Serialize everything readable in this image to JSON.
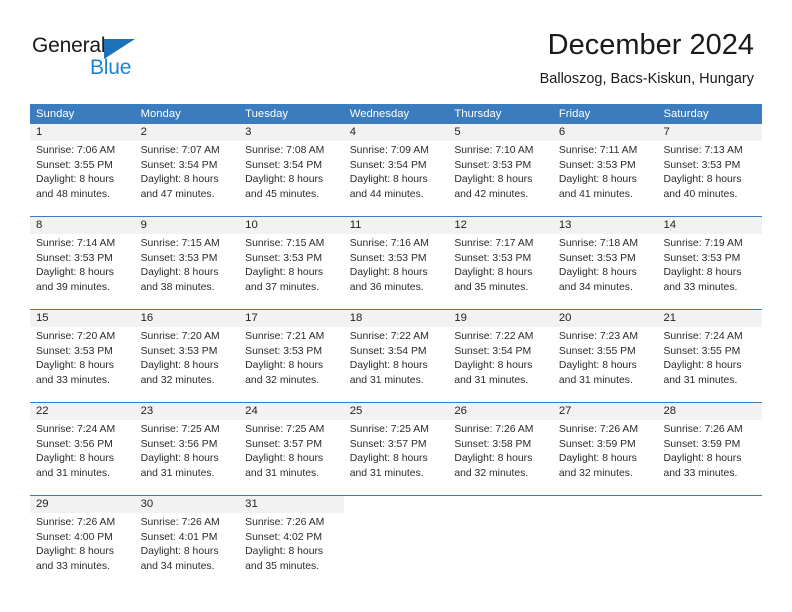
{
  "brand": {
    "name_dark": "General",
    "name_light": "Blue"
  },
  "header": {
    "title": "December 2024",
    "subtitle": "Balloszog, Bacs-Kiskun, Hungary"
  },
  "colors": {
    "header_blue": "#3a7cbe",
    "logo_blue": "#1c86d4",
    "daynum_bg": "#f2f2f2"
  },
  "weekdays": [
    "Sunday",
    "Monday",
    "Tuesday",
    "Wednesday",
    "Thursday",
    "Friday",
    "Saturday"
  ],
  "weeks": [
    [
      {
        "day": "1",
        "sunrise": "Sunrise: 7:06 AM",
        "sunset": "Sunset: 3:55 PM",
        "daylight1": "Daylight: 8 hours",
        "daylight2": "and 48 minutes."
      },
      {
        "day": "2",
        "sunrise": "Sunrise: 7:07 AM",
        "sunset": "Sunset: 3:54 PM",
        "daylight1": "Daylight: 8 hours",
        "daylight2": "and 47 minutes."
      },
      {
        "day": "3",
        "sunrise": "Sunrise: 7:08 AM",
        "sunset": "Sunset: 3:54 PM",
        "daylight1": "Daylight: 8 hours",
        "daylight2": "and 45 minutes."
      },
      {
        "day": "4",
        "sunrise": "Sunrise: 7:09 AM",
        "sunset": "Sunset: 3:54 PM",
        "daylight1": "Daylight: 8 hours",
        "daylight2": "and 44 minutes."
      },
      {
        "day": "5",
        "sunrise": "Sunrise: 7:10 AM",
        "sunset": "Sunset: 3:53 PM",
        "daylight1": "Daylight: 8 hours",
        "daylight2": "and 42 minutes."
      },
      {
        "day": "6",
        "sunrise": "Sunrise: 7:11 AM",
        "sunset": "Sunset: 3:53 PM",
        "daylight1": "Daylight: 8 hours",
        "daylight2": "and 41 minutes."
      },
      {
        "day": "7",
        "sunrise": "Sunrise: 7:13 AM",
        "sunset": "Sunset: 3:53 PM",
        "daylight1": "Daylight: 8 hours",
        "daylight2": "and 40 minutes."
      }
    ],
    [
      {
        "day": "8",
        "sunrise": "Sunrise: 7:14 AM",
        "sunset": "Sunset: 3:53 PM",
        "daylight1": "Daylight: 8 hours",
        "daylight2": "and 39 minutes."
      },
      {
        "day": "9",
        "sunrise": "Sunrise: 7:15 AM",
        "sunset": "Sunset: 3:53 PM",
        "daylight1": "Daylight: 8 hours",
        "daylight2": "and 38 minutes."
      },
      {
        "day": "10",
        "sunrise": "Sunrise: 7:15 AM",
        "sunset": "Sunset: 3:53 PM",
        "daylight1": "Daylight: 8 hours",
        "daylight2": "and 37 minutes."
      },
      {
        "day": "11",
        "sunrise": "Sunrise: 7:16 AM",
        "sunset": "Sunset: 3:53 PM",
        "daylight1": "Daylight: 8 hours",
        "daylight2": "and 36 minutes."
      },
      {
        "day": "12",
        "sunrise": "Sunrise: 7:17 AM",
        "sunset": "Sunset: 3:53 PM",
        "daylight1": "Daylight: 8 hours",
        "daylight2": "and 35 minutes."
      },
      {
        "day": "13",
        "sunrise": "Sunrise: 7:18 AM",
        "sunset": "Sunset: 3:53 PM",
        "daylight1": "Daylight: 8 hours",
        "daylight2": "and 34 minutes."
      },
      {
        "day": "14",
        "sunrise": "Sunrise: 7:19 AM",
        "sunset": "Sunset: 3:53 PM",
        "daylight1": "Daylight: 8 hours",
        "daylight2": "and 33 minutes."
      }
    ],
    [
      {
        "day": "15",
        "sunrise": "Sunrise: 7:20 AM",
        "sunset": "Sunset: 3:53 PM",
        "daylight1": "Daylight: 8 hours",
        "daylight2": "and 33 minutes."
      },
      {
        "day": "16",
        "sunrise": "Sunrise: 7:20 AM",
        "sunset": "Sunset: 3:53 PM",
        "daylight1": "Daylight: 8 hours",
        "daylight2": "and 32 minutes."
      },
      {
        "day": "17",
        "sunrise": "Sunrise: 7:21 AM",
        "sunset": "Sunset: 3:53 PM",
        "daylight1": "Daylight: 8 hours",
        "daylight2": "and 32 minutes."
      },
      {
        "day": "18",
        "sunrise": "Sunrise: 7:22 AM",
        "sunset": "Sunset: 3:54 PM",
        "daylight1": "Daylight: 8 hours",
        "daylight2": "and 31 minutes."
      },
      {
        "day": "19",
        "sunrise": "Sunrise: 7:22 AM",
        "sunset": "Sunset: 3:54 PM",
        "daylight1": "Daylight: 8 hours",
        "daylight2": "and 31 minutes."
      },
      {
        "day": "20",
        "sunrise": "Sunrise: 7:23 AM",
        "sunset": "Sunset: 3:55 PM",
        "daylight1": "Daylight: 8 hours",
        "daylight2": "and 31 minutes."
      },
      {
        "day": "21",
        "sunrise": "Sunrise: 7:24 AM",
        "sunset": "Sunset: 3:55 PM",
        "daylight1": "Daylight: 8 hours",
        "daylight2": "and 31 minutes."
      }
    ],
    [
      {
        "day": "22",
        "sunrise": "Sunrise: 7:24 AM",
        "sunset": "Sunset: 3:56 PM",
        "daylight1": "Daylight: 8 hours",
        "daylight2": "and 31 minutes."
      },
      {
        "day": "23",
        "sunrise": "Sunrise: 7:25 AM",
        "sunset": "Sunset: 3:56 PM",
        "daylight1": "Daylight: 8 hours",
        "daylight2": "and 31 minutes."
      },
      {
        "day": "24",
        "sunrise": "Sunrise: 7:25 AM",
        "sunset": "Sunset: 3:57 PM",
        "daylight1": "Daylight: 8 hours",
        "daylight2": "and 31 minutes."
      },
      {
        "day": "25",
        "sunrise": "Sunrise: 7:25 AM",
        "sunset": "Sunset: 3:57 PM",
        "daylight1": "Daylight: 8 hours",
        "daylight2": "and 31 minutes."
      },
      {
        "day": "26",
        "sunrise": "Sunrise: 7:26 AM",
        "sunset": "Sunset: 3:58 PM",
        "daylight1": "Daylight: 8 hours",
        "daylight2": "and 32 minutes."
      },
      {
        "day": "27",
        "sunrise": "Sunrise: 7:26 AM",
        "sunset": "Sunset: 3:59 PM",
        "daylight1": "Daylight: 8 hours",
        "daylight2": "and 32 minutes."
      },
      {
        "day": "28",
        "sunrise": "Sunrise: 7:26 AM",
        "sunset": "Sunset: 3:59 PM",
        "daylight1": "Daylight: 8 hours",
        "daylight2": "and 33 minutes."
      }
    ],
    [
      {
        "day": "29",
        "sunrise": "Sunrise: 7:26 AM",
        "sunset": "Sunset: 4:00 PM",
        "daylight1": "Daylight: 8 hours",
        "daylight2": "and 33 minutes."
      },
      {
        "day": "30",
        "sunrise": "Sunrise: 7:26 AM",
        "sunset": "Sunset: 4:01 PM",
        "daylight1": "Daylight: 8 hours",
        "daylight2": "and 34 minutes."
      },
      {
        "day": "31",
        "sunrise": "Sunrise: 7:26 AM",
        "sunset": "Sunset: 4:02 PM",
        "daylight1": "Daylight: 8 hours",
        "daylight2": "and 35 minutes."
      },
      {
        "day": "",
        "sunrise": "",
        "sunset": "",
        "daylight1": "",
        "daylight2": ""
      },
      {
        "day": "",
        "sunrise": "",
        "sunset": "",
        "daylight1": "",
        "daylight2": ""
      },
      {
        "day": "",
        "sunrise": "",
        "sunset": "",
        "daylight1": "",
        "daylight2": ""
      },
      {
        "day": "",
        "sunrise": "",
        "sunset": "",
        "daylight1": "",
        "daylight2": ""
      }
    ]
  ]
}
